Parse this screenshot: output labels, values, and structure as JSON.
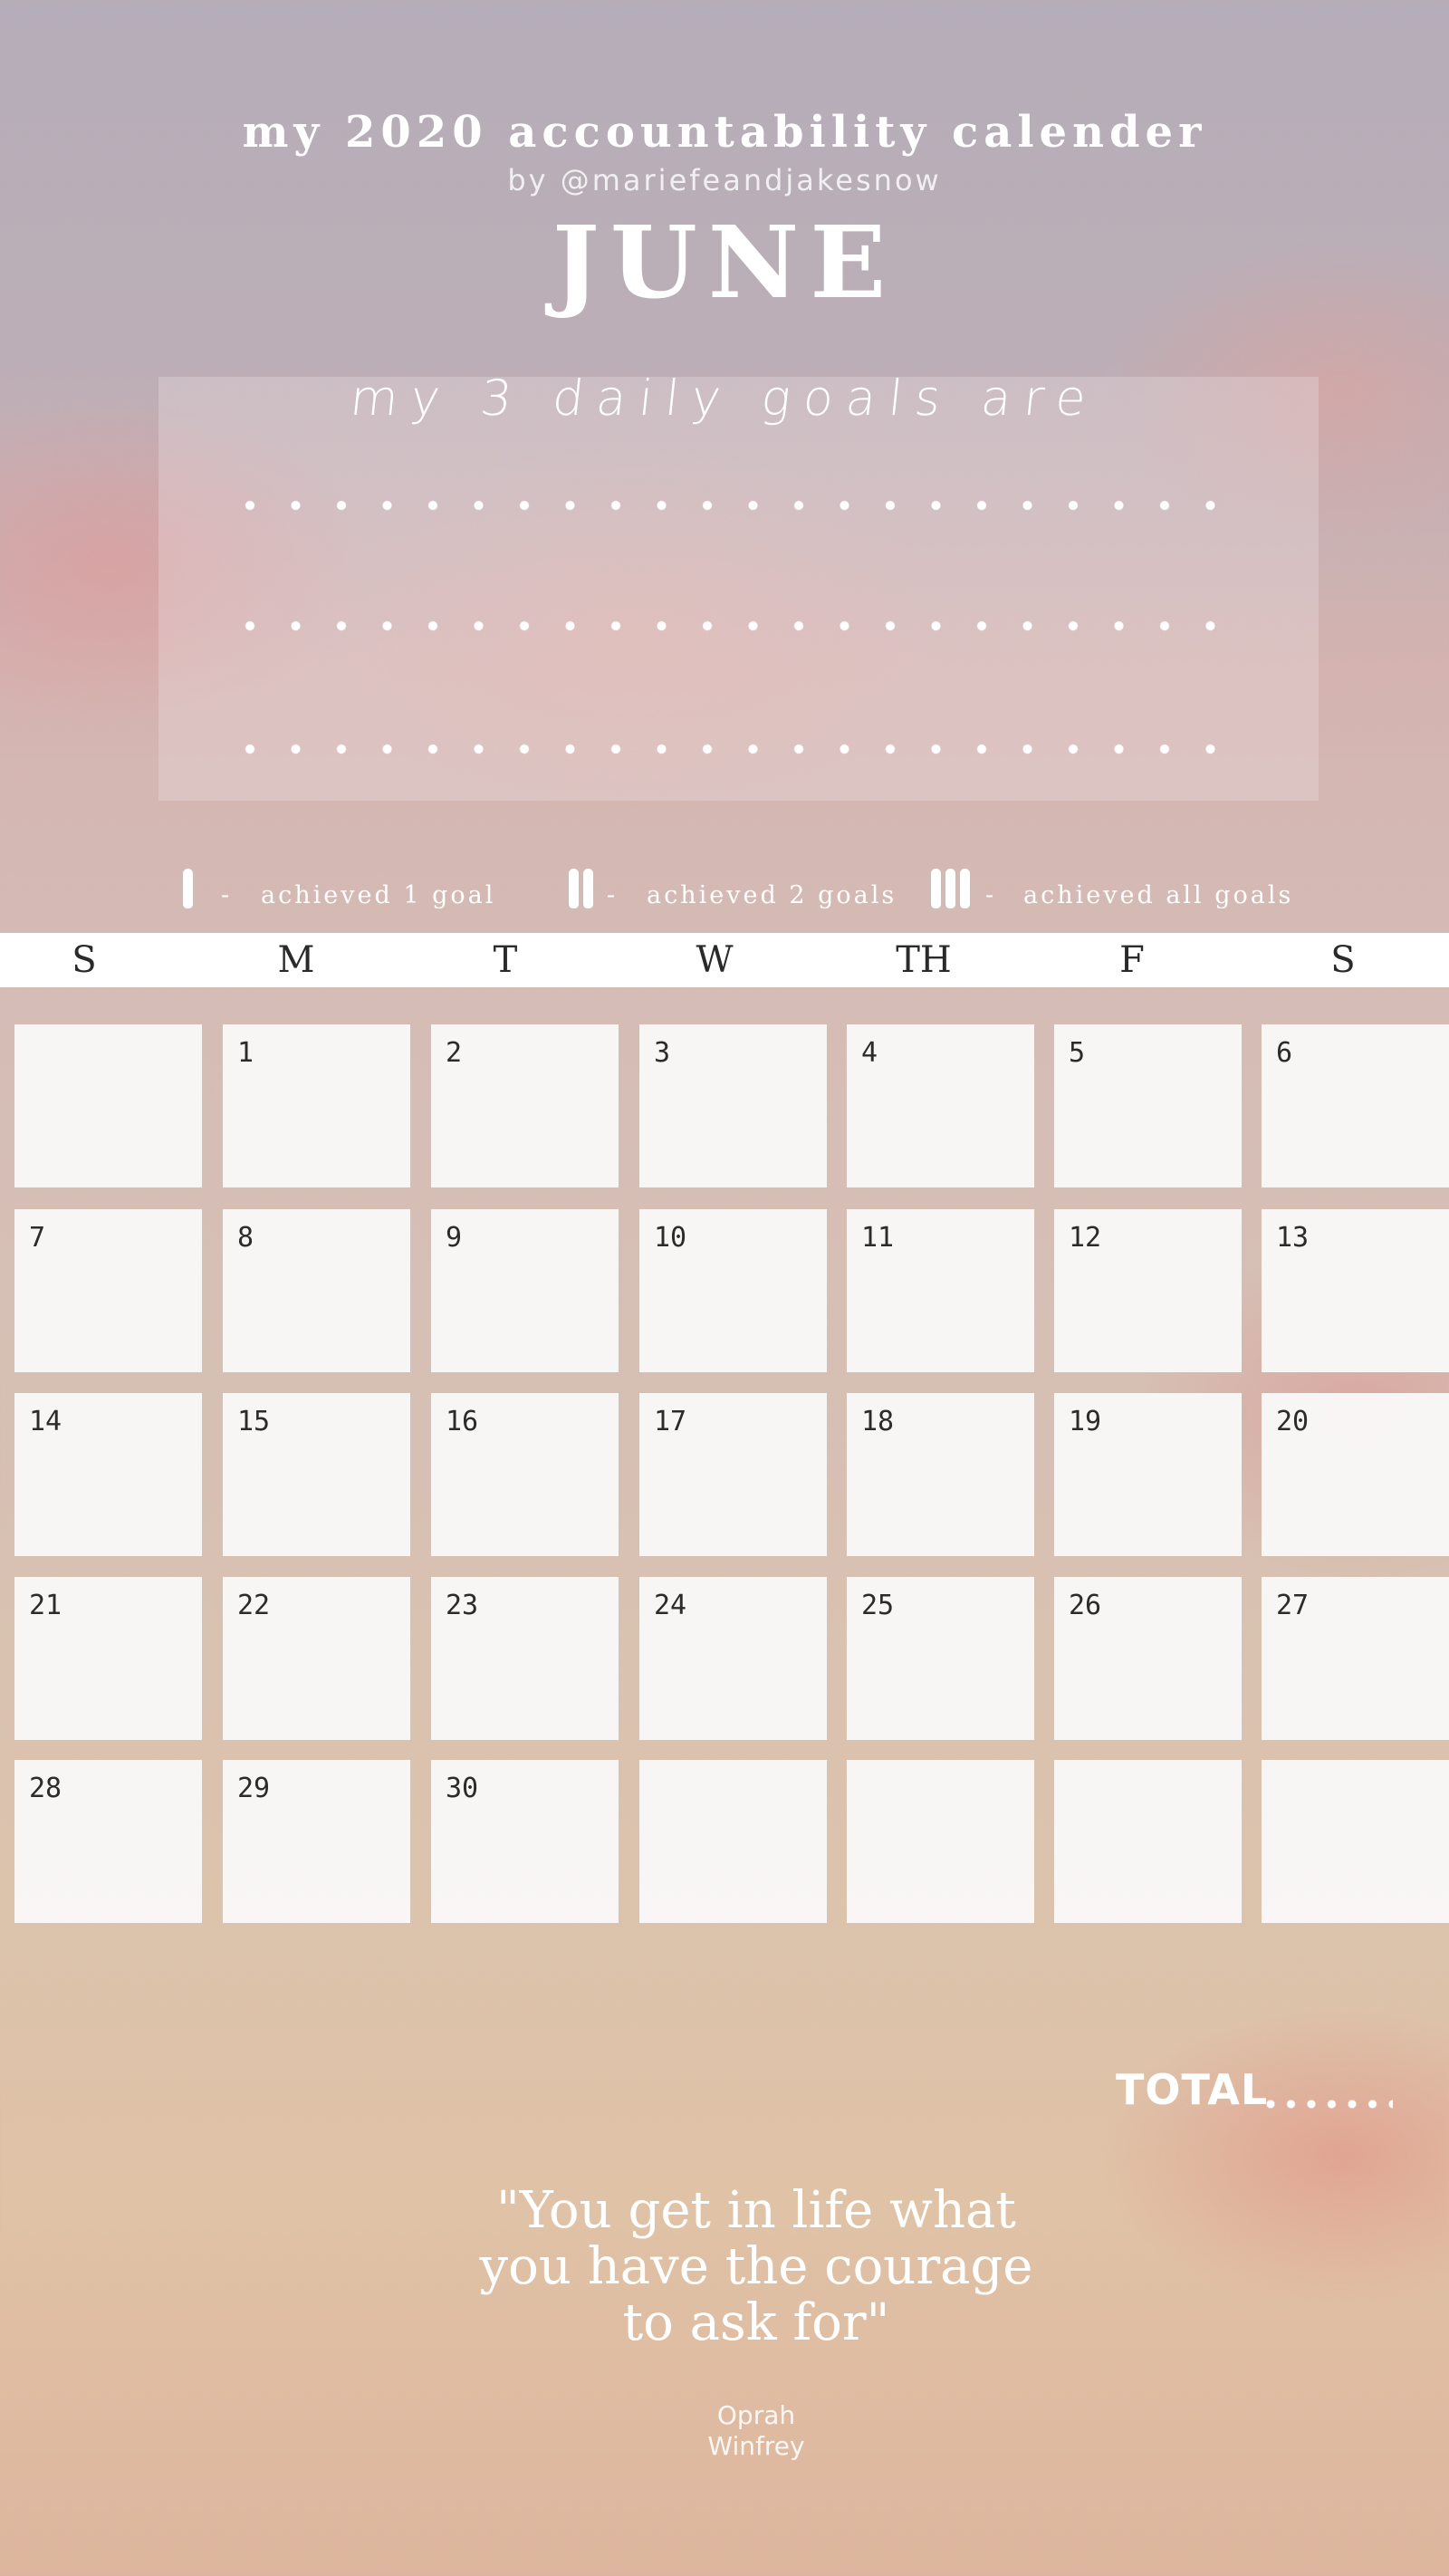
{
  "header": {
    "title": "my 2020 accountability calender",
    "byline": "by @mariefeandjakesnow",
    "month": "JUNE"
  },
  "goals": {
    "heading": "my 3 daily goals are",
    "lines": 3
  },
  "legend": [
    {
      "ticks": 1,
      "label": "achieved 1 goal"
    },
    {
      "ticks": 2,
      "label": "achieved 2 goals"
    },
    {
      "ticks": 3,
      "label": "achieved all goals"
    }
  ],
  "legend_separator": "-",
  "weekdays": [
    "S",
    "M",
    "T",
    "W",
    "TH",
    "F",
    "S"
  ],
  "calendar": {
    "weeks": [
      [
        "",
        "1",
        "2",
        "3",
        "4",
        "5",
        "6"
      ],
      [
        "7",
        "8",
        "9",
        "10",
        "11",
        "12",
        "13"
      ],
      [
        "14",
        "15",
        "16",
        "17",
        "18",
        "19",
        "20"
      ],
      [
        "21",
        "22",
        "23",
        "24",
        "25",
        "26",
        "27"
      ],
      [
        "28",
        "29",
        "30",
        "",
        "",
        "",
        ""
      ]
    ]
  },
  "total": {
    "label": "TOTAL"
  },
  "quote": {
    "text": "\"You get in life what\nyou have the courage\nto ask for\"",
    "author": "Oprah\nWinfrey"
  },
  "colors": {
    "text_light": "#ffffff",
    "text_dark": "#2a2a2a",
    "cell_bg": "#faf9f9"
  }
}
